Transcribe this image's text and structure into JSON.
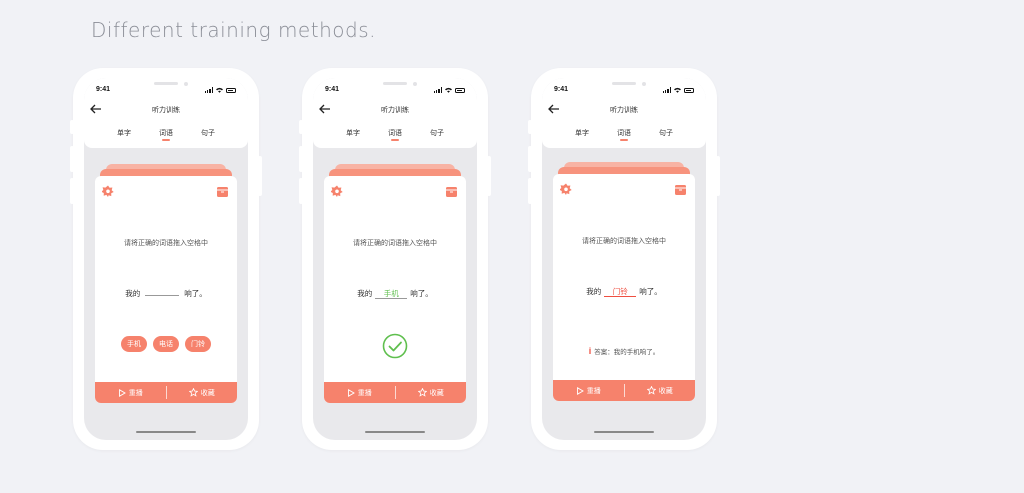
{
  "page": {
    "title": "Different training methods."
  },
  "colors": {
    "accent": "#f6826c",
    "success": "#5fbf4e",
    "error": "#ef4f41"
  },
  "icons": {
    "back": "arrow-left-icon",
    "settings": "gear-icon",
    "box": "archive-box-icon",
    "play": "play-icon",
    "star": "star-icon",
    "check": "check-circle-icon",
    "info": "info-icon"
  },
  "phones": [
    {
      "time": "9:41",
      "nav_title": "听力训练",
      "tabs": [
        "单字",
        "词语",
        "句子"
      ],
      "prompt": "请将正确的词语拖入空格中",
      "sentence_pre": "我的",
      "blank": "",
      "sentence_post": "响了。",
      "choices": [
        "手机",
        "电话",
        "门铃"
      ],
      "replay": "重播",
      "favorite": "收藏"
    },
    {
      "time": "9:41",
      "nav_title": "听力训练",
      "tabs": [
        "单字",
        "词语",
        "句子"
      ],
      "prompt": "请将正确的词语拖入空格中",
      "sentence_pre": "我的",
      "blank": "手机",
      "sentence_post": "响了。",
      "replay": "重播",
      "favorite": "收藏"
    },
    {
      "time": "9:41",
      "nav_title": "听力训练",
      "tabs": [
        "单字",
        "词语",
        "句子"
      ],
      "prompt": "请将正确的词语拖入空格中",
      "sentence_pre": "我的",
      "blank": "门铃",
      "sentence_post": "响了。",
      "answer_label": "答案：我的手机响了。",
      "replay": "重播",
      "favorite": "收藏"
    }
  ]
}
